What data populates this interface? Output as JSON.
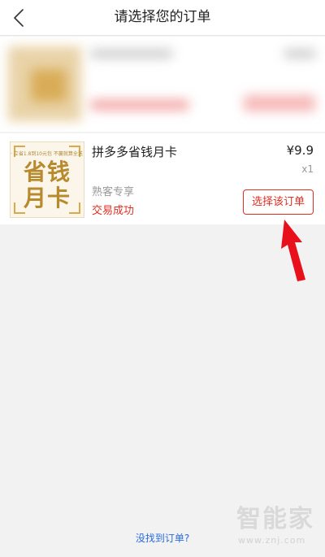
{
  "navbar": {
    "title": "请选择您的订单",
    "back_icon": "chevron-left-icon"
  },
  "blurred_order": {
    "note": ""
  },
  "order": {
    "product_name": "拼多多省钱月卡",
    "price": "¥9.9",
    "quantity": "x1",
    "tag": "熟客专享",
    "status": "交易成功",
    "select_label": "选择该订单",
    "thumbnail": {
      "line1": "省钱",
      "line2": "月卡",
      "caption": "· 立省1.8到10元包 不赢就算全送 ·"
    }
  },
  "footer": {
    "not_found_label": "没找到订单?"
  },
  "watermark": {
    "logo": "智能家",
    "url": "www.znj.com"
  },
  "colors": {
    "accent": "#e02e24",
    "link": "#2a6ae0",
    "background": "#f2f2f2"
  }
}
